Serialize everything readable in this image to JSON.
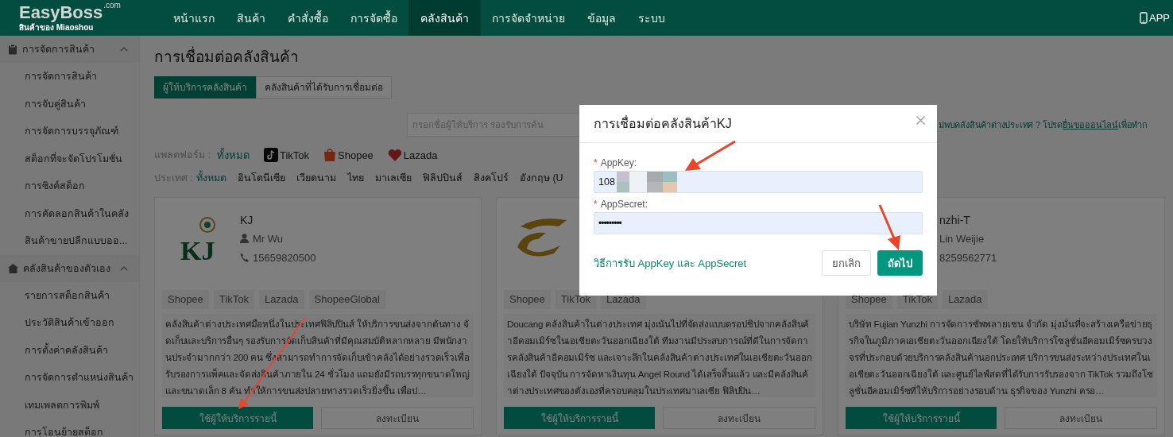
{
  "header": {
    "logo": "EasyBoss",
    "logo_suffix": ".com",
    "tagline": "สินค้าของ Miaoshou",
    "nav": [
      {
        "label": "หน้าแรก",
        "selected": false
      },
      {
        "label": "สินค้า",
        "selected": false
      },
      {
        "label": "คำสั่งซื้อ",
        "selected": false
      },
      {
        "label": "การจัดซื้อ",
        "selected": false
      },
      {
        "label": "คลังสินค้า",
        "selected": true
      },
      {
        "label": "การจัดจำหน่าย",
        "selected": false
      },
      {
        "label": "ข้อมูล",
        "selected": false
      },
      {
        "label": "ระบบ",
        "selected": false
      }
    ],
    "app_label": "APP"
  },
  "sidebar": {
    "groups": [
      {
        "label": "การจัดการสินค้า",
        "expanded": true,
        "items": [
          "การจัดการสินค้า",
          "การจับคู่สินค้า",
          "การจัดการบรรจุภัณฑ์",
          "สต็อกที่จะจัดโปรโมชั่น",
          "การซิงค์สต็อก",
          "การคัดลอกสินค้าในคลัง",
          "สินค้าขายปลีกแบบออ..."
        ]
      },
      {
        "label": "คลังสินค้าของตัวเอง",
        "expanded": true,
        "items": [
          "รายการสต็อกสินค้า",
          "ประวัติสินค้าเข้าออก",
          "การตั้งค่าคลังสินค้า",
          "การจัดการตำแหน่งสินค้า",
          "เทมเพลตการพิมพ์",
          "การโอนย้ายสต็อก"
        ]
      }
    ]
  },
  "page": {
    "title": "การเชื่อมต่อคลังสินค้า",
    "tabs": [
      {
        "label": "ผู้ให้บริการคลังสินค้า",
        "selected": true
      },
      {
        "label": "คลังสินค้าที่ได้รับการเชื่อมต่อ",
        "selected": false
      }
    ],
    "search": {
      "placeholder": "กรอกชื่อผู้ให้บริการ รองรับการค้น"
    },
    "notice": {
      "text": "ม่พบคลังสินค้าต่างประเทศ ? โปรด",
      "link": "ยื่นขอออนไลน์",
      "after": "เพื่อทำก"
    },
    "platform_filter": {
      "label": "แพลตฟอร์ม :",
      "options": [
        {
          "label": "ทั้งหมด",
          "selected": true,
          "kind": "all"
        },
        {
          "label": "TikTok",
          "selected": false,
          "kind": "tiktok"
        },
        {
          "label": "Shopee",
          "selected": false,
          "kind": "shopee"
        },
        {
          "label": "Lazada",
          "selected": false,
          "kind": "lazada"
        }
      ]
    },
    "country_filter": {
      "label": "ประเทศ :",
      "options": [
        {
          "label": "ทั้งหมด",
          "selected": true
        },
        {
          "label": "อินโดนีเซีย",
          "selected": false
        },
        {
          "label": "เวียดนาม",
          "selected": false
        },
        {
          "label": "ไทย",
          "selected": false
        },
        {
          "label": "มาเลเซีย",
          "selected": false
        },
        {
          "label": "ฟิลิปปินส์",
          "selected": false
        },
        {
          "label": "สิงคโปร์",
          "selected": false
        },
        {
          "label": "อังกฤษ (U",
          "selected": false
        }
      ]
    }
  },
  "cards": [
    {
      "logo": {
        "kind": "monogram",
        "text": "KJ"
      },
      "name": "KJ",
      "contact": "Mr Wu",
      "phone": "15659820500",
      "tags": [
        "Shopee",
        "TikTok",
        "Lazada",
        "ShopeeGlobal"
      ],
      "description": "คลังสินค้าต่างประเทศมือหนึ่งในประเทศฟิลิปปินส์ ให้บริการขนส่งจากต้นทาง จัดเก็บและบริการอื่นๆ รองรับการจัดเก็บสินค้าที่มีคุณสมบัติหลากหลาย มีพนักงานประจำมากกว่า 200 คน ซึ่งสามารถทำการจัดเก็บเข้าคลังได้อย่างรวดเร็วเพื่อรับรองการแพ็คและจัดส่งสินค้าภายใน 24 ชั่วโมง แถมยังมีรถบรรทุกขนาดใหญ่และขนาดเล็ก 8 คัน ทำให้การขนส่งปลายทางรวดเร็วยิ่งขึ้น เพื่อป…",
      "use_button": "ใช้ผู้ให้บริการรายนี้",
      "register_button": "ลงทะเบียน"
    },
    {
      "logo": {
        "kind": "swirl"
      },
      "tags": [
        "Shopee",
        "TikTok",
        "Lazada"
      ],
      "description": "Doucang คลังสินค้าในต่างประเทศ มุ่งเน้นไปที่จัดส่งแบบดรอปชิปจากคลังสินค้าอีคอมเมิร์ซในเอเชียตะวันออกเฉียงใต้ ทีมงานมีประสบการณ์ที่ดีในการจัดการคลังสินค้าอีคอมเมิร์ซ และเจาะลึกในคลังสินค้าต่างประเทศในเอเชียตะวันออกเฉียงใต้ ปัจจุบัน การจัดหาเงินทุน Angel Round ได้เสร็จสิ้นแล้ว และมีคลังสินค้าต่างประเทศของตังเองที่ครอบคลุมในประเทศมาเลเซีย ฟิลิปปิน…",
      "use_button": "ใช้ผู้ให้บริการรายนี้",
      "register_button": "ลงทะเบียน"
    },
    {
      "name": "nzhi-T",
      "contact": "Lin Weijie",
      "phone": "8259562771",
      "tags": [
        "Shopee",
        "TikTok",
        "Lazada"
      ],
      "description": "บริษัท Fujian Yunzhi การจัดการซัพพลายเชน จำกัด มุ่งมั่นที่จะสร้างเครือข่ายธุรกิจในภูมิภาคเอเชียตะวันออกเฉียงใต้ โดยให้บริการโซลูชั่นอีคอมเมิร์ซครบวงจรที่ประกอบด้วยบริการคลังสินค้านอกประเทศ บริการขนส่งระหว่างประเทศในเอเชียตะวันออกเฉียงใต้ และศูนย์ไลฟ์สดที่ได้รับการรับรองจาก TikTok รวมถึงโซลูชั่นอีคอมเมิร์ซที่ให้บริการอย่างรอบด้าน ธุรกิจของ Yunzhi ครอ…",
      "use_button": "ใช้ผู้ให้บริการรายนี้",
      "register_button": "ลงทะเบียน"
    }
  ],
  "dialog": {
    "title": "การเชื่อมต่อคลังสินค้าKJ",
    "fields": [
      {
        "required_mark": "*",
        "label": "AppKey:",
        "value": "108",
        "kind": "text"
      },
      {
        "required_mark": "*",
        "label": "AppSecret:",
        "value": "•••••••••",
        "kind": "password"
      }
    ],
    "help_link": "วิธีการรับ AppKey และ AppSecret",
    "buttons": [
      {
        "label": "ยกเลิก",
        "kind": "secondary"
      },
      {
        "label": "ถัดไป",
        "kind": "primary"
      }
    ]
  }
}
